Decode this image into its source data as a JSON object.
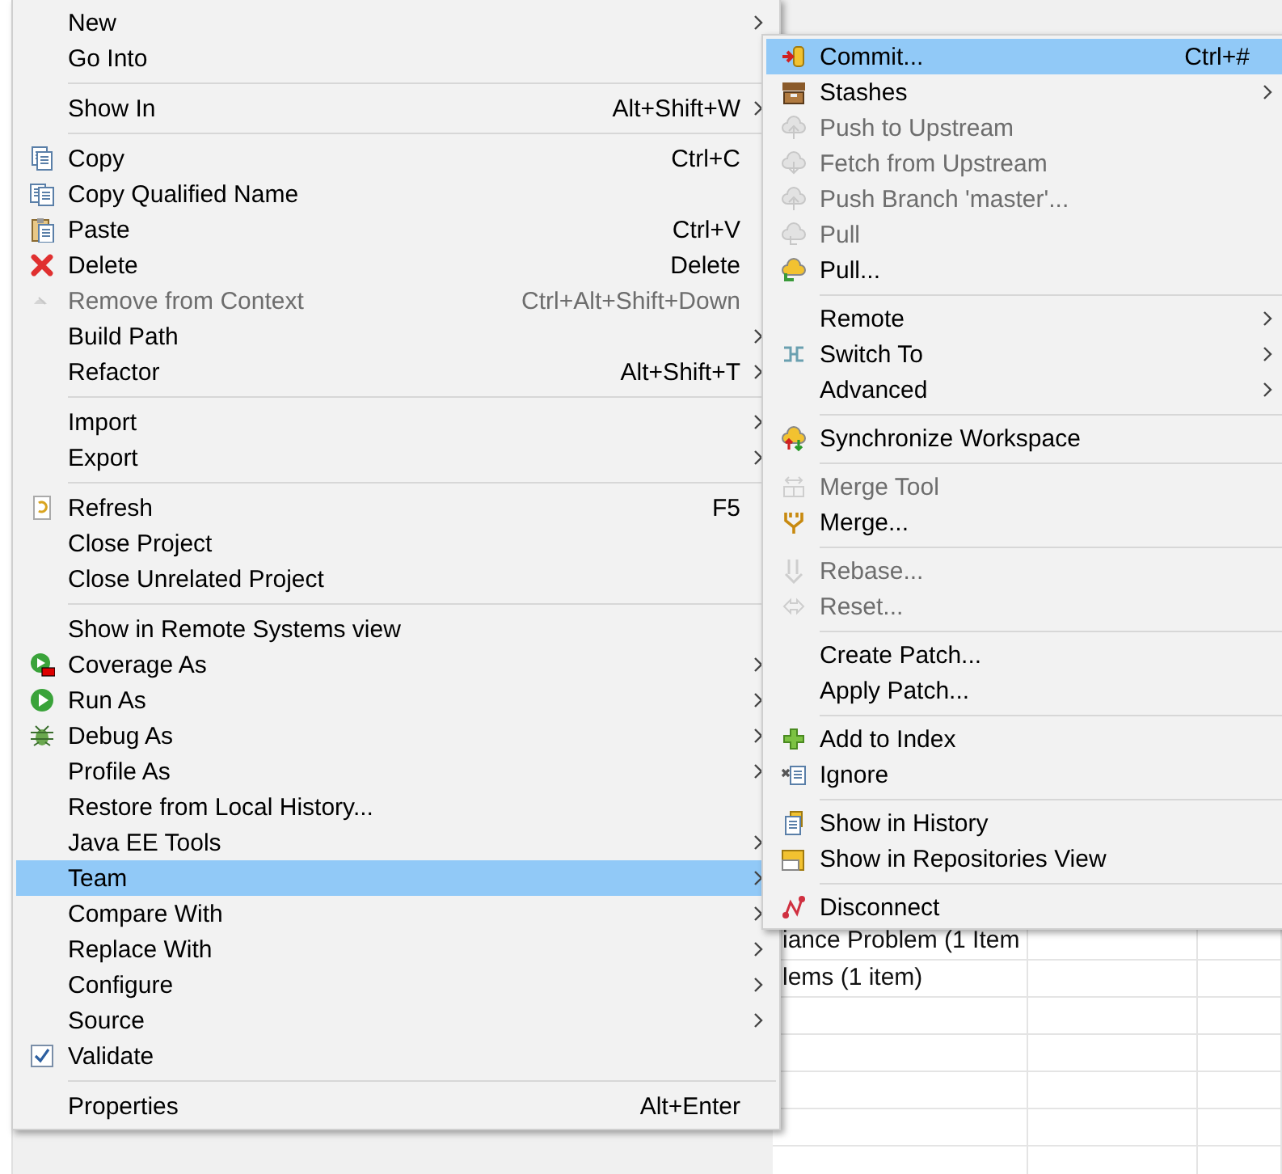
{
  "main_menu": {
    "items": [
      {
        "kind": "item",
        "label": "New",
        "submenu": true,
        "disabled": false,
        "selected": false,
        "checked": false
      },
      {
        "kind": "item",
        "label": "Go Into",
        "submenu": false,
        "disabled": false,
        "selected": false,
        "checked": false
      },
      {
        "kind": "separator"
      },
      {
        "kind": "item",
        "label": "Show In",
        "shortcut": "Alt+Shift+W",
        "submenu": true,
        "disabled": false,
        "selected": false,
        "checked": false
      },
      {
        "kind": "separator"
      },
      {
        "kind": "item",
        "label": "Copy",
        "shortcut": "Ctrl+C",
        "submenu": false,
        "disabled": false,
        "selected": false,
        "checked": false
      },
      {
        "kind": "item",
        "label": "Copy Qualified Name",
        "submenu": false,
        "disabled": false,
        "selected": false,
        "checked": false
      },
      {
        "kind": "item",
        "label": "Paste",
        "shortcut": "Ctrl+V",
        "submenu": false,
        "disabled": false,
        "selected": false,
        "checked": false
      },
      {
        "kind": "item",
        "label": "Delete",
        "shortcut": "Delete",
        "submenu": false,
        "disabled": false,
        "selected": false,
        "checked": false
      },
      {
        "kind": "item",
        "label": "Remove from Context",
        "shortcut": "Ctrl+Alt+Shift+Down",
        "submenu": false,
        "disabled": true,
        "selected": false,
        "checked": false
      },
      {
        "kind": "item",
        "label": "Build Path",
        "submenu": true,
        "disabled": false,
        "selected": false,
        "checked": false
      },
      {
        "kind": "item",
        "label": "Refactor",
        "shortcut": "Alt+Shift+T",
        "submenu": true,
        "disabled": false,
        "selected": false,
        "checked": false
      },
      {
        "kind": "separator"
      },
      {
        "kind": "item",
        "label": "Import",
        "submenu": true,
        "disabled": false,
        "selected": false,
        "checked": false
      },
      {
        "kind": "item",
        "label": "Export",
        "submenu": true,
        "disabled": false,
        "selected": false,
        "checked": false
      },
      {
        "kind": "separator"
      },
      {
        "kind": "item",
        "label": "Refresh",
        "shortcut": "F5",
        "submenu": false,
        "disabled": false,
        "selected": false,
        "checked": false
      },
      {
        "kind": "item",
        "label": "Close Project",
        "submenu": false,
        "disabled": false,
        "selected": false,
        "checked": false
      },
      {
        "kind": "item",
        "label": "Close Unrelated Project",
        "submenu": false,
        "disabled": false,
        "selected": false,
        "checked": false
      },
      {
        "kind": "separator"
      },
      {
        "kind": "item",
        "label": "Show in Remote Systems view",
        "submenu": false,
        "disabled": false,
        "selected": false,
        "checked": false
      },
      {
        "kind": "item",
        "label": "Coverage As",
        "submenu": true,
        "disabled": false,
        "selected": false,
        "checked": false
      },
      {
        "kind": "item",
        "label": "Run As",
        "submenu": true,
        "disabled": false,
        "selected": false,
        "checked": false
      },
      {
        "kind": "item",
        "label": "Debug As",
        "submenu": true,
        "disabled": false,
        "selected": false,
        "checked": false
      },
      {
        "kind": "item",
        "label": "Profile As",
        "submenu": true,
        "disabled": false,
        "selected": false,
        "checked": false
      },
      {
        "kind": "item",
        "label": "Restore from Local History...",
        "submenu": false,
        "disabled": false,
        "selected": false,
        "checked": false
      },
      {
        "kind": "item",
        "label": "Java EE Tools",
        "submenu": true,
        "disabled": false,
        "selected": false,
        "checked": false
      },
      {
        "kind": "item",
        "label": "Team",
        "submenu": true,
        "disabled": false,
        "selected": true,
        "checked": false
      },
      {
        "kind": "item",
        "label": "Compare With",
        "submenu": true,
        "disabled": false,
        "selected": false,
        "checked": false
      },
      {
        "kind": "item",
        "label": "Replace With",
        "submenu": true,
        "disabled": false,
        "selected": false,
        "checked": false
      },
      {
        "kind": "item",
        "label": "Configure",
        "submenu": true,
        "disabled": false,
        "selected": false,
        "checked": false
      },
      {
        "kind": "item",
        "label": "Source",
        "submenu": true,
        "disabled": false,
        "selected": false,
        "checked": false
      },
      {
        "kind": "item",
        "label": "Validate",
        "submenu": false,
        "disabled": false,
        "selected": false,
        "checked": true
      },
      {
        "kind": "separator"
      },
      {
        "kind": "item",
        "label": "Properties",
        "shortcut": "Alt+Enter",
        "submenu": false,
        "disabled": false,
        "selected": false,
        "checked": false
      }
    ]
  },
  "team_menu": {
    "items": [
      {
        "kind": "item",
        "label": "Commit...",
        "shortcut": "Ctrl+#",
        "submenu": false,
        "disabled": false,
        "selected": true
      },
      {
        "kind": "item",
        "label": "Stashes",
        "submenu": true,
        "disabled": false,
        "selected": false
      },
      {
        "kind": "item",
        "label": "Push to Upstream",
        "submenu": false,
        "disabled": true,
        "selected": false
      },
      {
        "kind": "item",
        "label": "Fetch from Upstream",
        "submenu": false,
        "disabled": true,
        "selected": false
      },
      {
        "kind": "item",
        "label": "Push Branch 'master'...",
        "submenu": false,
        "disabled": true,
        "selected": false
      },
      {
        "kind": "item",
        "label": "Pull",
        "submenu": false,
        "disabled": true,
        "selected": false
      },
      {
        "kind": "item",
        "label": "Pull...",
        "submenu": false,
        "disabled": false,
        "selected": false
      },
      {
        "kind": "separator"
      },
      {
        "kind": "item",
        "label": "Remote",
        "submenu": true,
        "disabled": false,
        "selected": false
      },
      {
        "kind": "item",
        "label": "Switch To",
        "submenu": true,
        "disabled": false,
        "selected": false
      },
      {
        "kind": "item",
        "label": "Advanced",
        "submenu": true,
        "disabled": false,
        "selected": false
      },
      {
        "kind": "separator"
      },
      {
        "kind": "item",
        "label": "Synchronize Workspace",
        "submenu": false,
        "disabled": false,
        "selected": false
      },
      {
        "kind": "separator"
      },
      {
        "kind": "item",
        "label": "Merge Tool",
        "submenu": false,
        "disabled": true,
        "selected": false
      },
      {
        "kind": "item",
        "label": "Merge...",
        "submenu": false,
        "disabled": false,
        "selected": false
      },
      {
        "kind": "separator"
      },
      {
        "kind": "item",
        "label": "Rebase...",
        "submenu": false,
        "disabled": true,
        "selected": false
      },
      {
        "kind": "item",
        "label": "Reset...",
        "submenu": false,
        "disabled": true,
        "selected": false
      },
      {
        "kind": "separator"
      },
      {
        "kind": "item",
        "label": "Create Patch...",
        "submenu": false,
        "disabled": false,
        "selected": false
      },
      {
        "kind": "item",
        "label": "Apply Patch...",
        "submenu": false,
        "disabled": false,
        "selected": false
      },
      {
        "kind": "separator"
      },
      {
        "kind": "item",
        "label": "Add to Index",
        "submenu": false,
        "disabled": false,
        "selected": false
      },
      {
        "kind": "item",
        "label": "Ignore",
        "submenu": false,
        "disabled": false,
        "selected": false
      },
      {
        "kind": "separator"
      },
      {
        "kind": "item",
        "label": "Show in History",
        "submenu": false,
        "disabled": false,
        "selected": false
      },
      {
        "kind": "item",
        "label": "Show in Repositories View",
        "submenu": false,
        "disabled": false,
        "selected": false
      },
      {
        "kind": "separator"
      },
      {
        "kind": "item",
        "label": "Disconnect",
        "submenu": false,
        "disabled": false,
        "selected": false
      }
    ]
  },
  "problems_table": {
    "rows": [
      {
        "column_1": "iance Problem (1 Item"
      },
      {
        "column_1": "lems (1 item)"
      }
    ]
  }
}
